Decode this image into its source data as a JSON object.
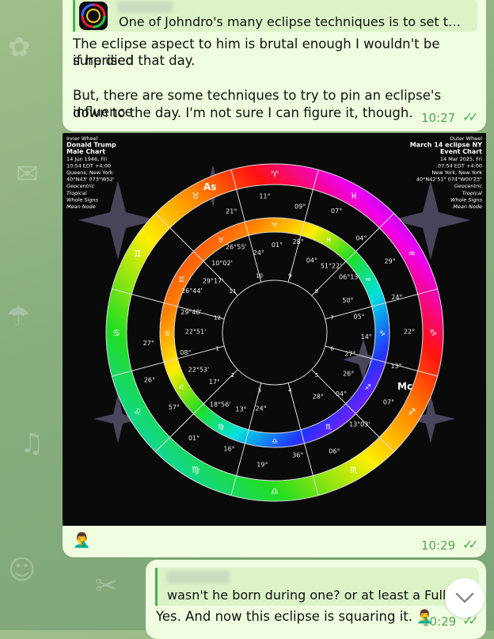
{
  "messages": [
    {
      "quote_text": "One of Johndro's many eclipse techniques is to set the ec...",
      "lines": [
        "The eclipse aspect to him is brutal enough I wouldn't be surprised",
        "if he died that day.",
        "",
        "But, there are some techniques to try to pin an eclipse's influence",
        "down to the day. I'm not sure I can figure it, though."
      ],
      "time": "10:27"
    },
    {
      "caption_emoji": "🤦‍♂️",
      "time": "10:29"
    },
    {
      "quote_text": "wasn't he born during one? or at least a Full M",
      "text": "Yes. And now this eclipse is squaring it. 🤦‍♂️",
      "time": "10:29"
    }
  ],
  "chart": {
    "inner_header": [
      "Inner Wheel",
      "Donald Trump",
      "Male Chart",
      "14 Jun 1946, Fri",
      "10:54 EDT +4:00",
      "Queens, New York",
      "40°N43' 073°W52'",
      "Geocentric",
      "Tropical",
      "Whole Signs",
      "Mean Node"
    ],
    "outer_header": [
      "Outer Wheel",
      "March 14 eclipse NY",
      "Event Chart",
      "14 Mar 2025, Fri",
      "07:54 EDT +4:00",
      "New York, New York",
      "40°N42'51\" 074°W00'23\"",
      "Geocentric",
      "Tropical",
      "Whole Signs",
      "Mean Node"
    ],
    "sign_glyphs": [
      "♈",
      "♉",
      "♊",
      "♋",
      "♌",
      "♍",
      "♎",
      "♏",
      "♐",
      "♑",
      "♒",
      "♓"
    ],
    "house_numbers": [
      "1",
      "2",
      "3",
      "4",
      "5",
      "6",
      "7",
      "8",
      "9",
      "10",
      "11",
      "12"
    ],
    "inner_labels": [
      "24°",
      "13°",
      "18°56'",
      "17°",
      "22°53'",
      "08°",
      "22°51'",
      "29°48'",
      "26°44'",
      "29°17'",
      "10°02'",
      "26°55'",
      "24°",
      "01°",
      "28°",
      "04°",
      "51°22'",
      "06°13'",
      "50°",
      "05°",
      "14°",
      "27°",
      "26°",
      "04°",
      "28°"
    ],
    "outer_labels": [
      "21°",
      "11°",
      "09°",
      "07°",
      "04°",
      "29°",
      "24°",
      "22°",
      "13°",
      "07°",
      "13°03'",
      "06°",
      "36°",
      "19°",
      "16°",
      "01°",
      "57°",
      "26°",
      "27°"
    ],
    "mid_labels": [
      "As",
      "Mc"
    ]
  },
  "colors": {
    "ticks": "#4fae4e",
    "time": "#5aa35a"
  }
}
